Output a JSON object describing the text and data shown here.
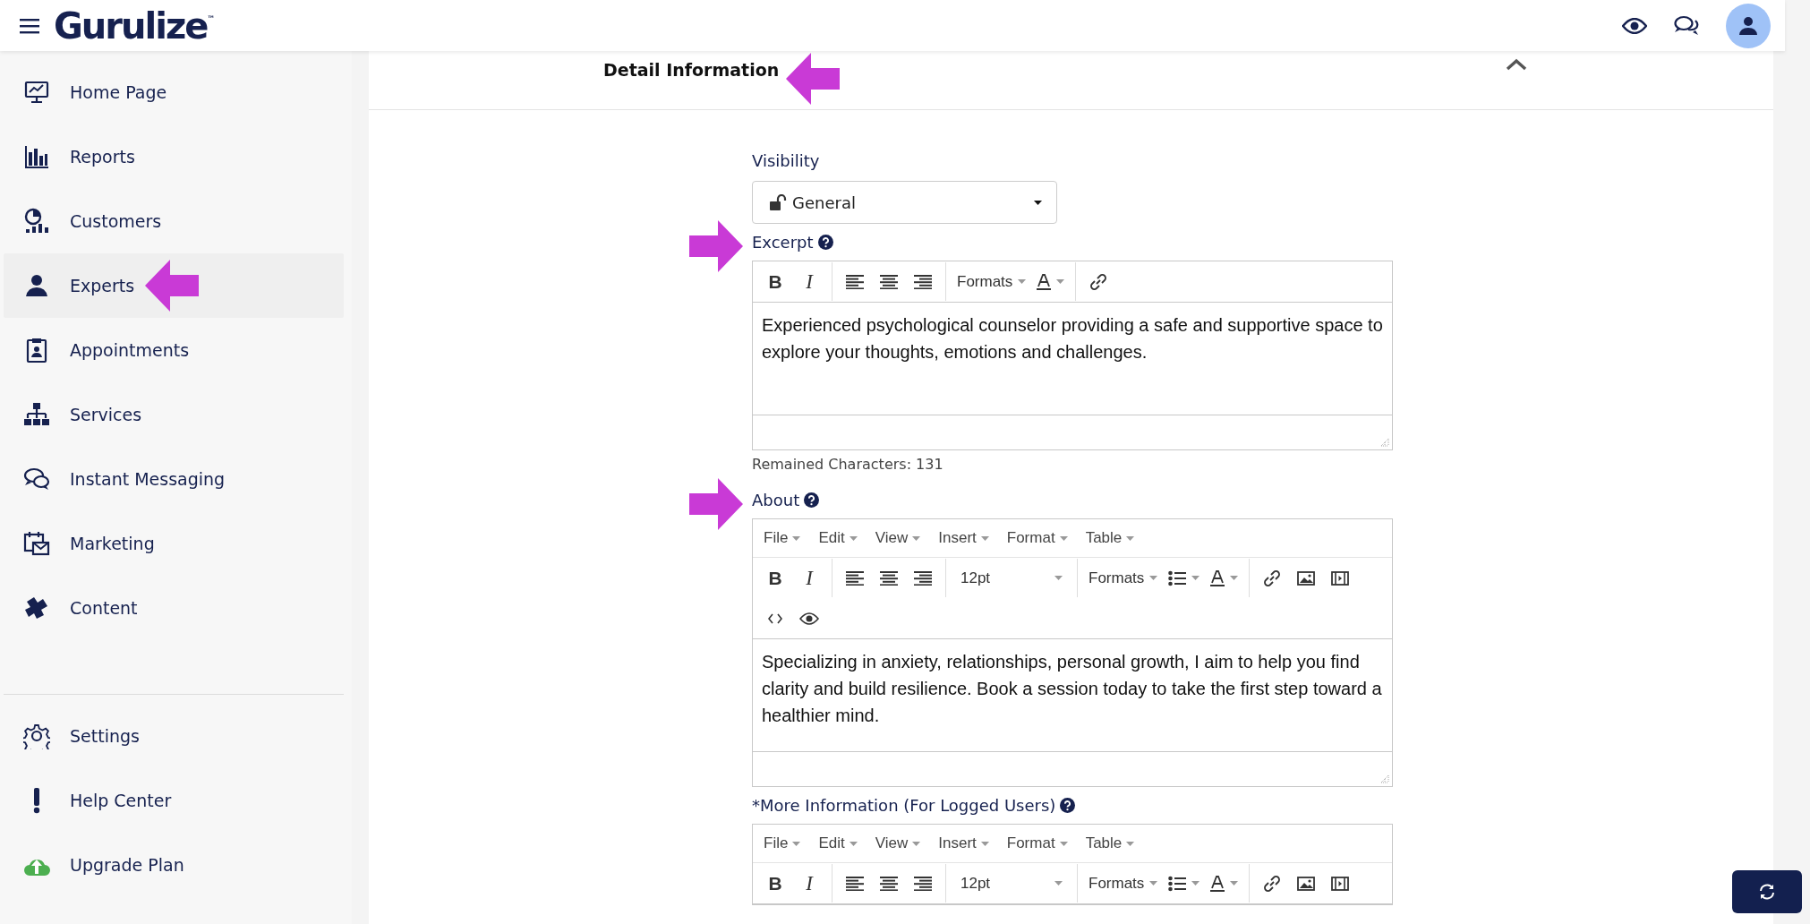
{
  "header": {
    "logo": "Gurulize",
    "logo_mark": "™"
  },
  "sidebar": {
    "items": [
      {
        "label": "Home Page",
        "selected": false
      },
      {
        "label": "Reports",
        "selected": false
      },
      {
        "label": "Customers",
        "selected": false
      },
      {
        "label": "Experts",
        "selected": true
      },
      {
        "label": "Appointments",
        "selected": false
      },
      {
        "label": "Services",
        "selected": false
      },
      {
        "label": "Instant Messaging",
        "selected": false
      },
      {
        "label": "Marketing",
        "selected": false
      },
      {
        "label": "Content",
        "selected": false
      }
    ],
    "bottom_items": [
      {
        "label": "Settings",
        "selected": false
      },
      {
        "label": "Help Center",
        "selected": false
      },
      {
        "label": "Upgrade Plan",
        "selected": false
      }
    ]
  },
  "section": {
    "title": "Detail Information",
    "expanded": true
  },
  "visibility": {
    "label": "Visibility",
    "value": "General"
  },
  "editors": [
    {
      "label": "Excerpt",
      "help": true,
      "toolbar": [
        [
          {
            "kind": "bold",
            "label": "B"
          },
          {
            "kind": "italic",
            "label": "I"
          },
          {
            "kind": "separator"
          },
          {
            "kind": "align_left"
          },
          {
            "kind": "align_center"
          },
          {
            "kind": "align_right"
          },
          {
            "kind": "separator"
          },
          {
            "kind": "formats",
            "label": "Formats"
          },
          {
            "kind": "color"
          },
          {
            "kind": "separator"
          },
          {
            "kind": "link"
          }
        ]
      ],
      "content": "Experienced psychological counselor providing a safe and supportive space to explore your thoughts, emotions and challenges.",
      "footer": "Remained Characters: 131"
    },
    {
      "label": "About",
      "help": true,
      "menus": [
        "File",
        "Edit",
        "View",
        "Insert",
        "Format",
        "Table"
      ],
      "toolbar": [
        [
          {
            "kind": "bold",
            "label": "B"
          },
          {
            "kind": "italic",
            "label": "I"
          },
          {
            "kind": "separator"
          },
          {
            "kind": "align_left"
          },
          {
            "kind": "align_center"
          },
          {
            "kind": "align_right"
          },
          {
            "kind": "separator"
          },
          {
            "kind": "size",
            "label": "12pt"
          },
          {
            "kind": "separator"
          },
          {
            "kind": "formats",
            "label": "Formats"
          },
          {
            "kind": "bullets"
          },
          {
            "kind": "color"
          },
          {
            "kind": "separator"
          },
          {
            "kind": "link"
          },
          {
            "kind": "image"
          },
          {
            "kind": "media"
          }
        ],
        [
          {
            "kind": "code"
          },
          {
            "kind": "preview"
          }
        ]
      ],
      "content": "Specializing in anxiety, relationships, personal growth, I aim to help you find clarity and build resilience. Book a session today to take the first step toward a healthier mind."
    },
    {
      "label": "*More Information (For Logged Users)",
      "help": true,
      "menus": [
        "File",
        "Edit",
        "View",
        "Insert",
        "Format",
        "Table"
      ],
      "toolbar": [
        [
          {
            "kind": "bold",
            "label": "B"
          },
          {
            "kind": "italic",
            "label": "I"
          },
          {
            "kind": "separator"
          },
          {
            "kind": "align_left"
          },
          {
            "kind": "align_center"
          },
          {
            "kind": "align_right"
          },
          {
            "kind": "separator"
          },
          {
            "kind": "size",
            "label": "12pt"
          },
          {
            "kind": "separator"
          },
          {
            "kind": "formats",
            "label": "Formats"
          },
          {
            "kind": "bullets"
          },
          {
            "kind": "color"
          },
          {
            "kind": "separator"
          },
          {
            "kind": "link"
          },
          {
            "kind": "image"
          },
          {
            "kind": "media"
          }
        ]
      ]
    }
  ]
}
